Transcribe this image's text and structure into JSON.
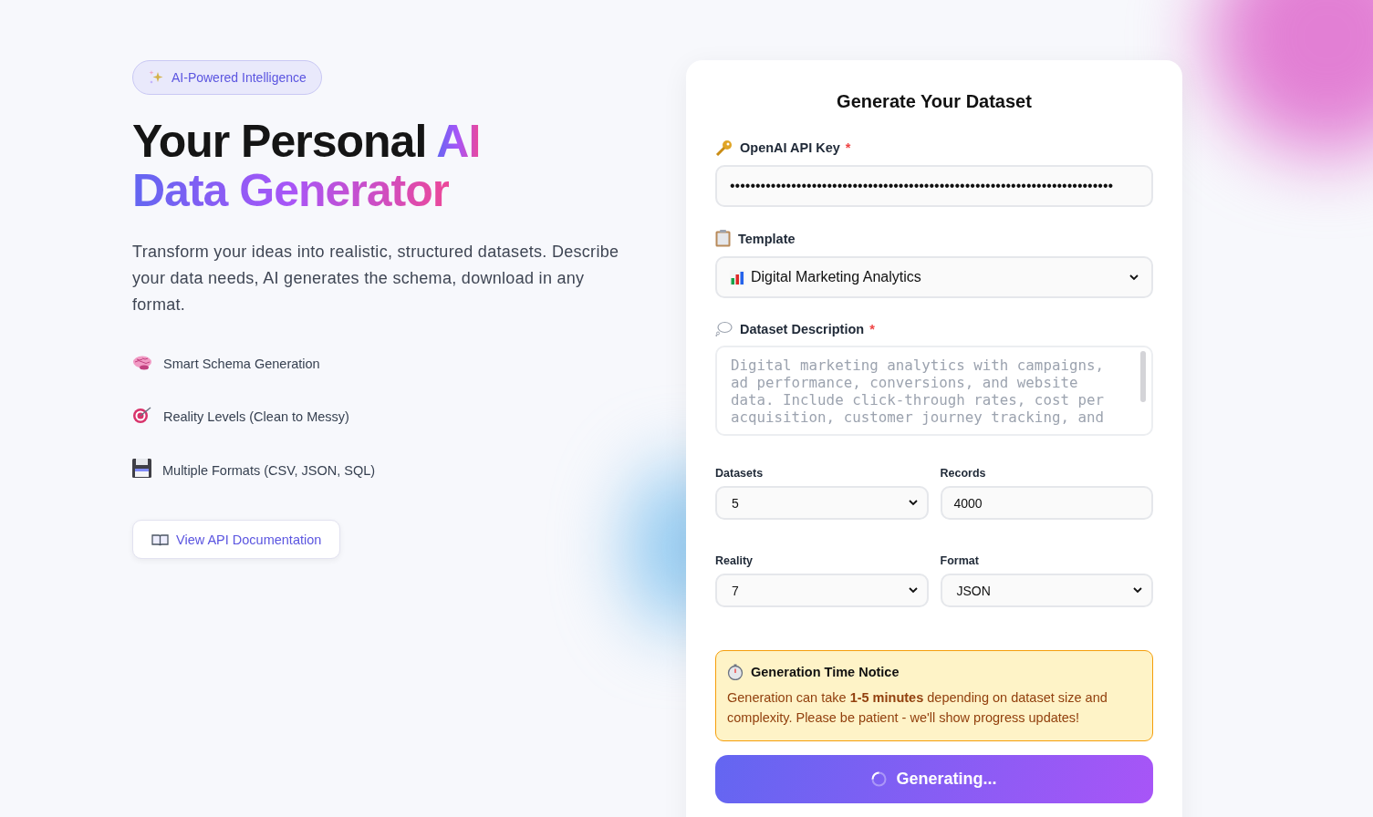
{
  "badge": {
    "text": "AI-Powered Intelligence"
  },
  "hero": {
    "lines": [
      [
        {
          "text": "Your Personal",
          "accent": false
        },
        {
          "text": "AI",
          "accent": true
        }
      ],
      [
        {
          "text": "Data Generator",
          "accent": true
        }
      ]
    ],
    "description": "Transform your ideas into realistic, structured datasets. Describe your data needs, AI generates the schema, download in any format."
  },
  "features": [
    {
      "kind": "brain",
      "text": "Smart Schema Generation"
    },
    {
      "kind": "target",
      "text": "Reality Levels (Clean to Messy)"
    },
    {
      "kind": "floppy",
      "text": "Multiple Formats (CSV, JSON, SQL)"
    }
  ],
  "docs_button": {
    "text": "View API Documentation"
  },
  "form": {
    "title": "Generate Your Dataset",
    "api_key": {
      "label": "OpenAI API Key",
      "required_mark": "*",
      "value": "•••••••••••••••••••••••••••••••••••••••••••••••••••••••••••••••••••••••••••"
    },
    "template": {
      "label": "Template",
      "value": "Digital Marketing Analytics"
    },
    "description": {
      "label": "Dataset Description",
      "required_mark": "*",
      "placeholder": "Digital marketing analytics with campaigns, ad performance, conversions, and website data. Include click-through rates, cost per acquisition, customer journey tracking, and"
    },
    "settings": [
      {
        "kind": "select",
        "label": "Datasets",
        "value": "5"
      },
      {
        "kind": "input",
        "label": "Records",
        "value": "4000"
      },
      {
        "kind": "select",
        "label": "Reality",
        "value": "7"
      },
      {
        "kind": "select",
        "label": "Format",
        "value": "JSON"
      }
    ],
    "notice": {
      "title": "Generation Time Notice",
      "body": "Generation can take **1-5 minutes** depending on dataset size and complexity. Please be patient - we'll show progress updates!"
    },
    "submit": {
      "text": "Generating...",
      "loading": true
    }
  }
}
